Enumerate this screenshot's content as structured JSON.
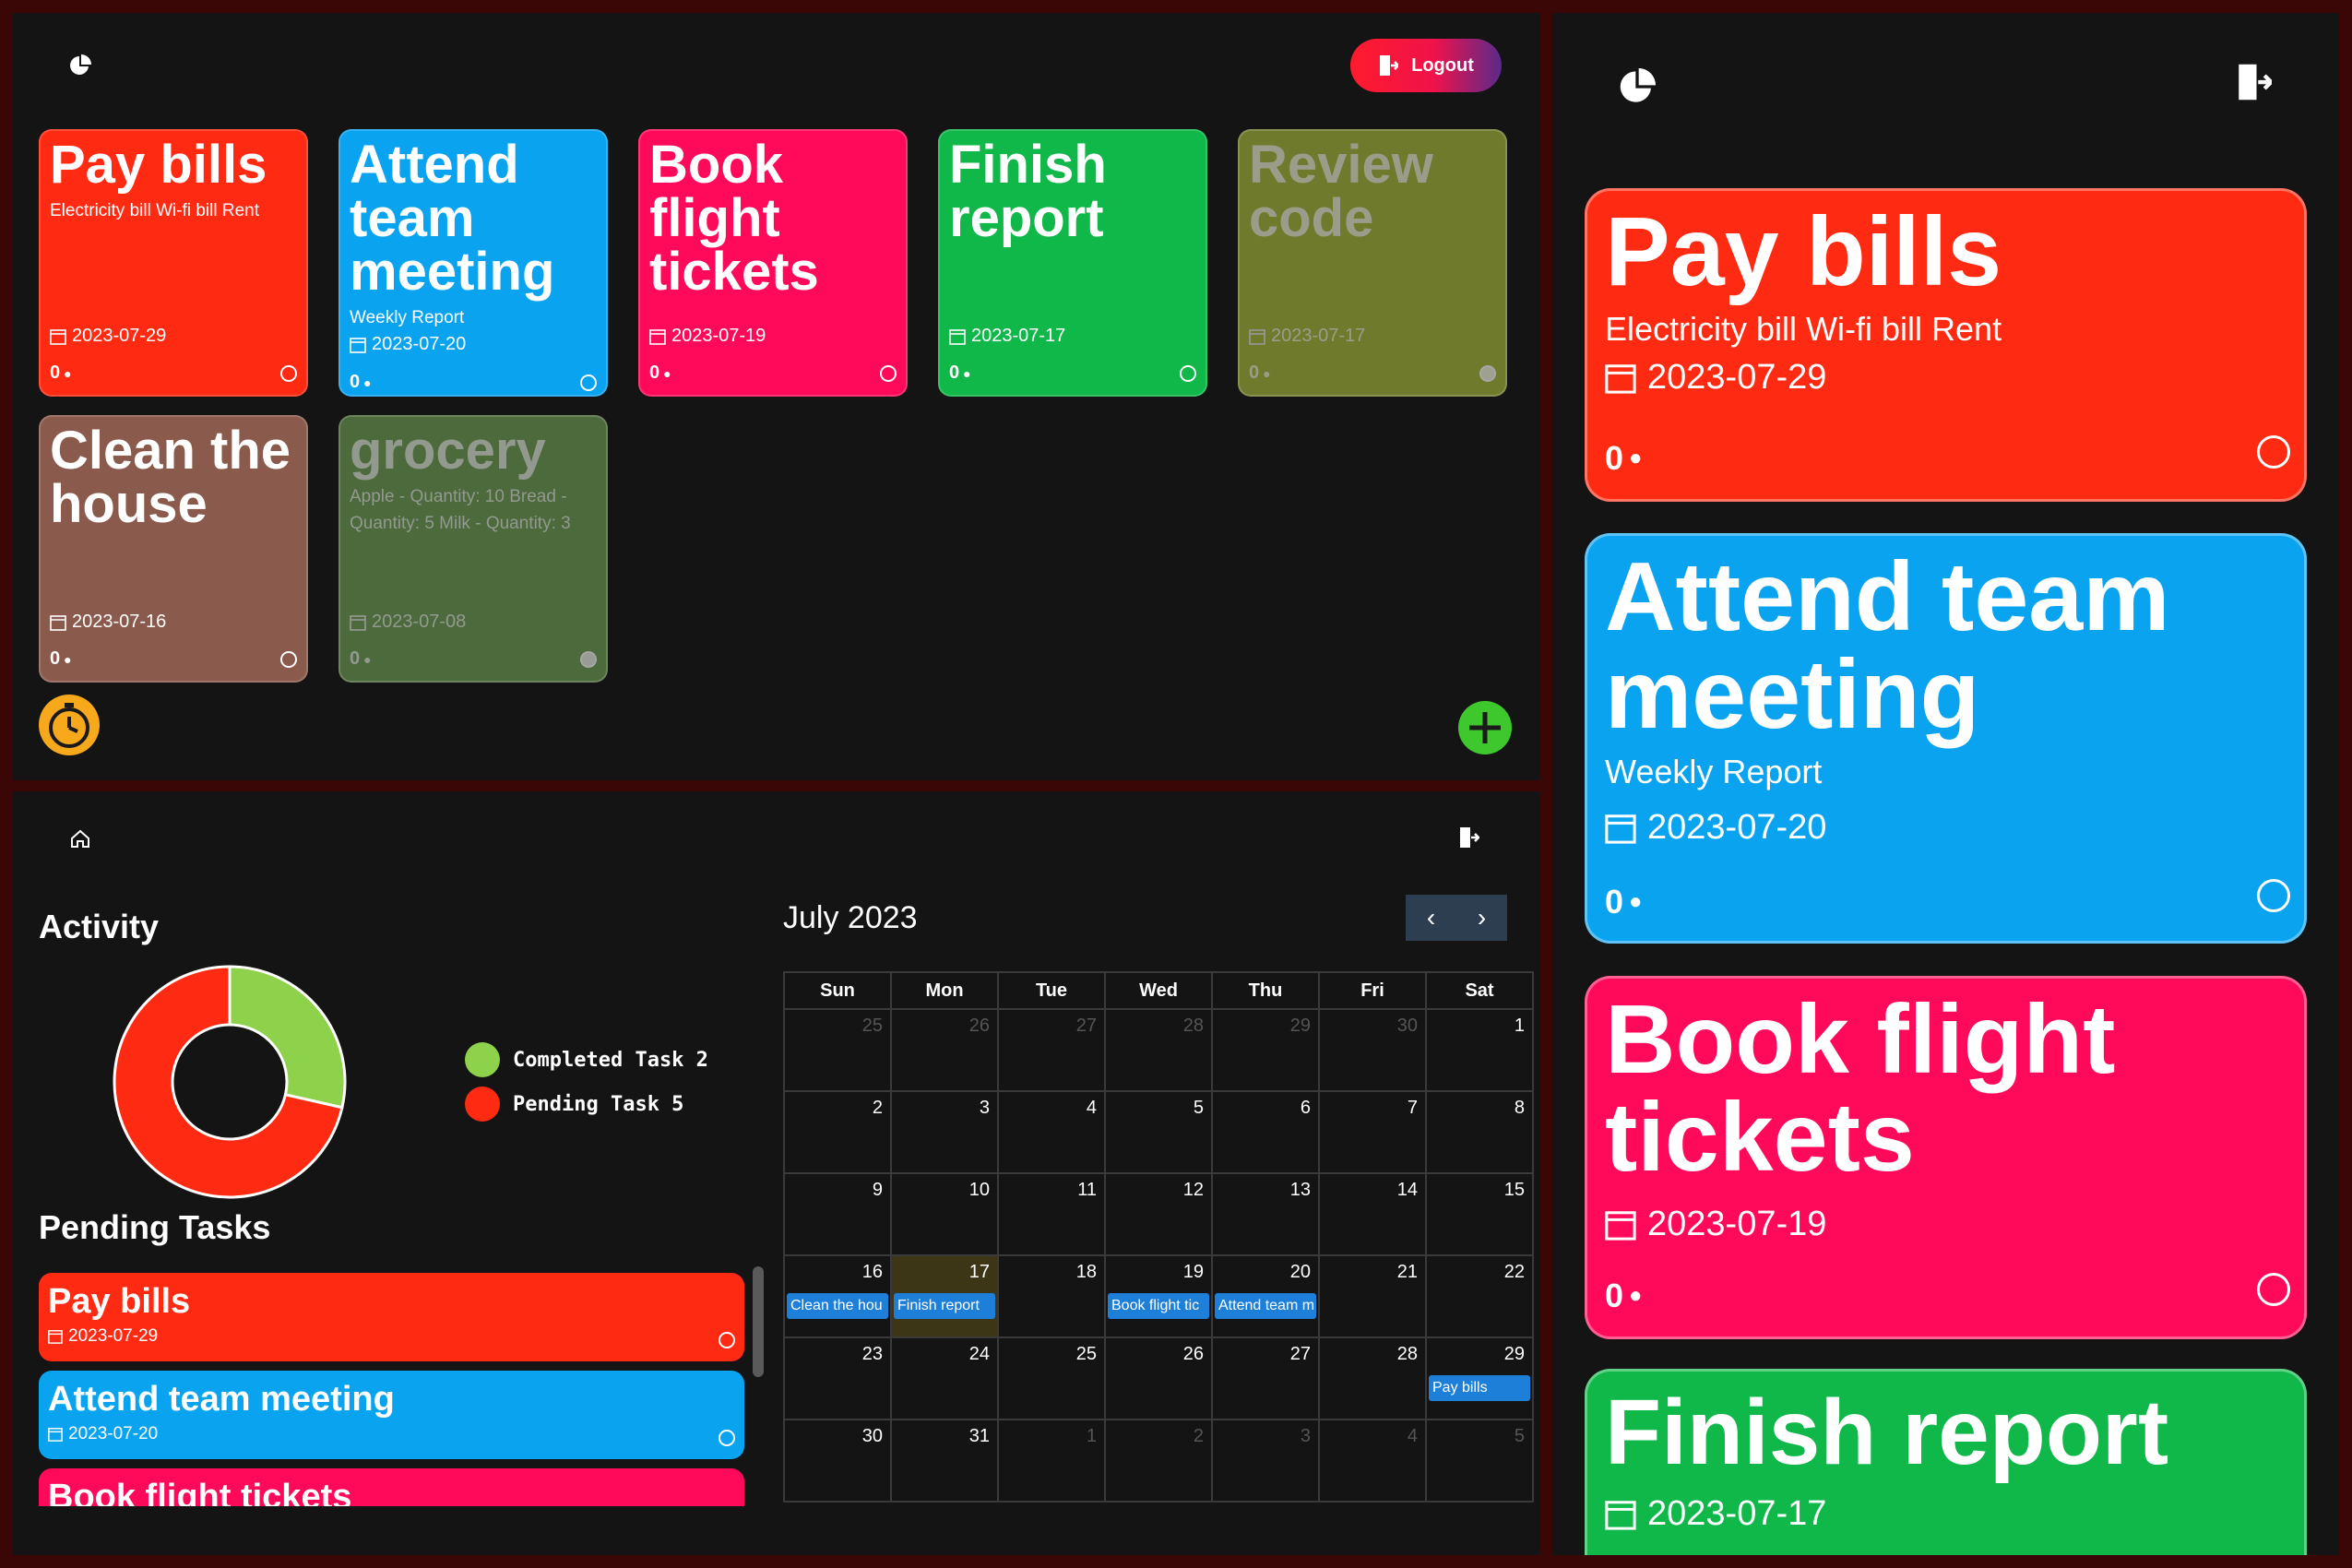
{
  "colors": {
    "red": "#ff2a12",
    "blue": "#0aa3f0",
    "pink": "#ff0a5a",
    "green": "#0fb849",
    "olive": "#6f7a2c",
    "brown": "#8a5a4c",
    "dark_green": "#4d6a3c",
    "background": "#141414",
    "frame": "#3b0606"
  },
  "dashboard": {
    "header": {
      "logo_icon": "pie-chart-icon",
      "logout_label": "Logout",
      "logout_icon": "logout-door-icon"
    },
    "tasks": [
      {
        "title": "Pay bills",
        "description": "Electricity bill Wi-fi bill Rent",
        "date": "2023-07-29",
        "count": "0",
        "completed": false
      },
      {
        "title": "Attend team meeting",
        "description": "Weekly Report",
        "date": "2023-07-20",
        "count": "0",
        "completed": false
      },
      {
        "title": "Book flight tickets",
        "description": "",
        "date": "2023-07-19",
        "count": "0",
        "completed": false
      },
      {
        "title": "Finish report",
        "description": "",
        "date": "2023-07-17",
        "count": "0",
        "completed": false
      },
      {
        "title": "Review code",
        "description": "",
        "date": "2023-07-17",
        "count": "0",
        "completed": true
      },
      {
        "title": "Clean the house",
        "description": "",
        "date": "2023-07-16",
        "count": "0",
        "completed": false
      },
      {
        "title": "grocery",
        "description": "Apple - Quantity: 10 Bread - Quantity: 5 Milk - Quantity: 3",
        "date": "2023-07-08",
        "count": "0",
        "completed": true
      }
    ],
    "timer_icon": "stopwatch-icon",
    "add_icon": "plus-icon"
  },
  "activity_view": {
    "header": {
      "home_icon": "home-icon",
      "logout_icon": "logout-door-icon"
    },
    "activity_title": "Activity",
    "chart_data": {
      "type": "pie",
      "variant": "donut",
      "categories": [
        "Completed Task",
        "Pending Task"
      ],
      "values": [
        2,
        5
      ],
      "colors": [
        "#8ed14a",
        "#ff2a12"
      ],
      "legend": [
        "Completed Task 2",
        "Pending Task 5"
      ],
      "legend_placement": "right"
    },
    "pending_title": "Pending Tasks",
    "pending_tasks": [
      {
        "title": "Pay bills",
        "date": "2023-07-29"
      },
      {
        "title": "Attend team meeting",
        "date": "2023-07-20"
      },
      {
        "title": "Book flight tickets",
        "date": ""
      }
    ],
    "calendar": {
      "month_label": "July 2023",
      "prev": "‹",
      "next": "›",
      "weekdays": [
        "Sun",
        "Mon",
        "Tue",
        "Wed",
        "Thu",
        "Fri",
        "Sat"
      ],
      "weeks": [
        [
          {
            "d": "25",
            "o": true
          },
          {
            "d": "26",
            "o": true
          },
          {
            "d": "27",
            "o": true
          },
          {
            "d": "28",
            "o": true
          },
          {
            "d": "29",
            "o": true
          },
          {
            "d": "30",
            "o": true
          },
          {
            "d": "1"
          }
        ],
        [
          {
            "d": "2"
          },
          {
            "d": "3"
          },
          {
            "d": "4"
          },
          {
            "d": "5"
          },
          {
            "d": "6"
          },
          {
            "d": "7"
          },
          {
            "d": "8"
          }
        ],
        [
          {
            "d": "9"
          },
          {
            "d": "10"
          },
          {
            "d": "11"
          },
          {
            "d": "12"
          },
          {
            "d": "13"
          },
          {
            "d": "14"
          },
          {
            "d": "15"
          }
        ],
        [
          {
            "d": "16",
            "e": "Clean the hou"
          },
          {
            "d": "17",
            "e": "Finish report",
            "t": true
          },
          {
            "d": "18"
          },
          {
            "d": "19",
            "e": "Book flight tic"
          },
          {
            "d": "20",
            "e": "Attend team m"
          },
          {
            "d": "21"
          },
          {
            "d": "22"
          }
        ],
        [
          {
            "d": "23"
          },
          {
            "d": "24"
          },
          {
            "d": "25"
          },
          {
            "d": "26"
          },
          {
            "d": "27"
          },
          {
            "d": "28"
          },
          {
            "d": "29",
            "e": "Pay bills"
          }
        ],
        [
          {
            "d": "30"
          },
          {
            "d": "31"
          },
          {
            "d": "1",
            "o": true
          },
          {
            "d": "2",
            "o": true
          },
          {
            "d": "3",
            "o": true
          },
          {
            "d": "4",
            "o": true
          },
          {
            "d": "5",
            "o": true
          }
        ]
      ]
    }
  },
  "mobile_view": {
    "header": {
      "logo_icon": "pie-chart-icon",
      "logout_icon": "logout-door-icon"
    },
    "tasks": [
      {
        "title": "Pay bills",
        "description": "Electricity bill Wi-fi bill Rent",
        "date": "2023-07-29",
        "count": "0"
      },
      {
        "title": "Attend team meeting",
        "description": "Weekly Report",
        "date": "2023-07-20",
        "count": "0"
      },
      {
        "title": "Book flight tickets",
        "description": "",
        "date": "2023-07-19",
        "count": "0"
      },
      {
        "title": "Finish report",
        "description": "",
        "date": "2023-07-17",
        "count": ""
      }
    ]
  }
}
